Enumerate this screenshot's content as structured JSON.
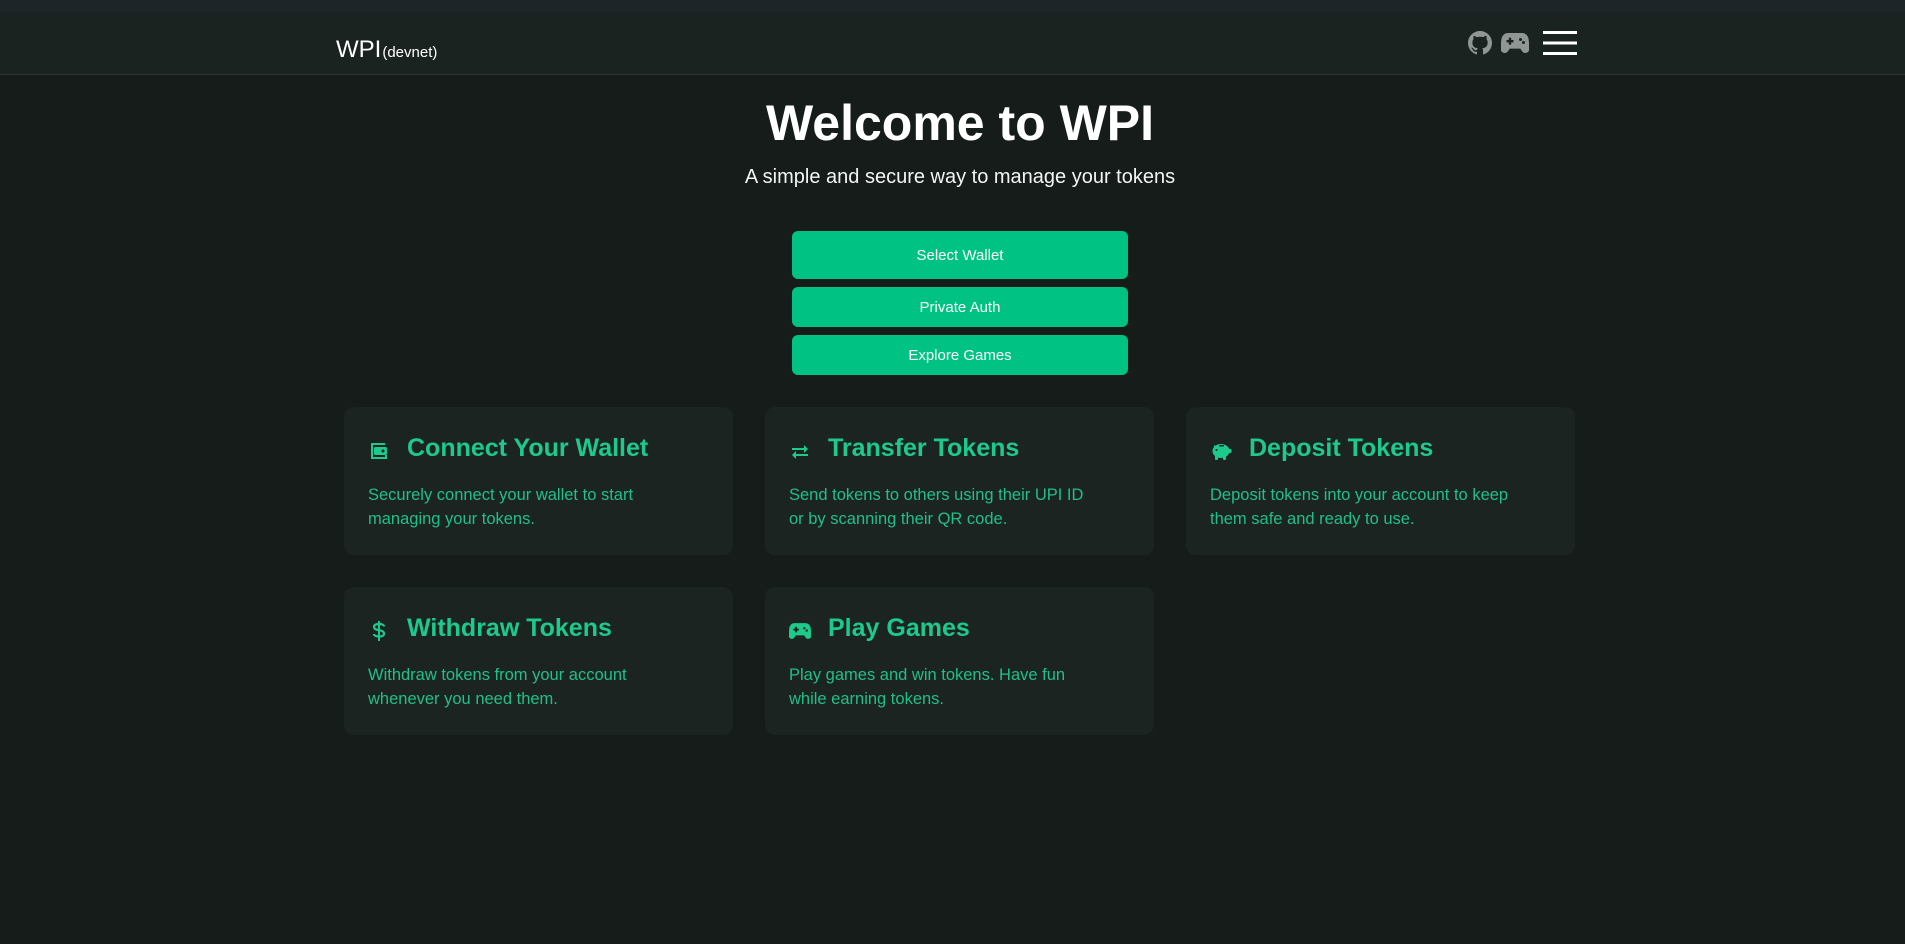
{
  "brand": {
    "name": "WPI",
    "network": "(devnet)"
  },
  "nav": {
    "icons": [
      "github-icon",
      "gamepad-icon",
      "hamburger-menu-icon"
    ]
  },
  "hero": {
    "title": "Welcome to WPI",
    "subtitle": "A simple and secure way to manage your tokens"
  },
  "actions": {
    "select_wallet": "Select Wallet",
    "private_auth": "Private Auth",
    "explore_games": "Explore Games"
  },
  "features": [
    {
      "icon": "wallet-icon",
      "title": "Connect Your Wallet",
      "desc": "Securely connect your wallet to start managing your tokens."
    },
    {
      "icon": "transfer-arrows-icon",
      "title": "Transfer Tokens",
      "desc": "Send tokens to others using their UPI ID or by scanning their QR code."
    },
    {
      "icon": "piggy-bank-icon",
      "title": "Deposit Tokens",
      "desc": "Deposit tokens into your account to keep them safe and ready to use."
    },
    {
      "icon": "dollar-icon",
      "title": "Withdraw Tokens",
      "desc": "Withdraw tokens from your account whenever you need them."
    },
    {
      "icon": "gamepad-icon",
      "title": "Play Games",
      "desc": "Play games and win tokens. Have fun while earning tokens."
    }
  ],
  "colors": {
    "background": "#151c19",
    "navbar": "#1b2321",
    "card": "#1c2422",
    "accent": "#00c383",
    "accent_text": "#1ec98c"
  }
}
